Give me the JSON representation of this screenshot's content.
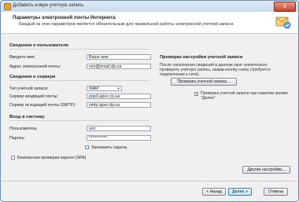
{
  "window": {
    "title": "Добавить новую учетную запись",
    "close_glyph": "x"
  },
  "header": {
    "title": "Параметры электронной почты Интернета",
    "subtitle": "Каждый из этих параметров является обязательным для правильной работы электронной учетной записи."
  },
  "user_info": {
    "heading": "Сведения о пользователе",
    "name_label": "Введите имя:",
    "name_value": "Ваше имя",
    "email_label": "Адрес электронной почты:",
    "email_value": "ven@email.dp.ua"
  },
  "server_info": {
    "heading": "Сведения о сервере",
    "account_type_label": "Тип учетной записи:",
    "account_type_value": "IMAP",
    "incoming_label": "Сервер входящей почты:",
    "incoming_value": "pop3.apex.cp.ua",
    "outgoing_label": "Сервер исходящей почты (SMTP):",
    "outgoing_value": "smtp.apex.dp.ua"
  },
  "login": {
    "heading": "Вход в систему",
    "user_label": "Пользователь:",
    "user_value": "ven",
    "password_label": "Пароль:",
    "password_value": "**********",
    "remember_label": "Запомнить пароль",
    "remember_checked": false,
    "spa_label": "Безопасная проверка пароля (SPA)",
    "spa_checked": false
  },
  "test": {
    "heading": "Проверка настройки учетной записи",
    "description": "После заполнения сведений в данном окне значительно проверить учетную запись, нажав кнопку снизу (требуется подключение к сети).",
    "test_button": "Проверка учетной записи...",
    "auto_test_label": "Проверка учетной записи при нажатии кнопки \"Далее\"",
    "auto_test_checked": true,
    "check_glyph": "✓"
  },
  "buttons": {
    "more_settings": "Другие настройки...",
    "back": "< Назад",
    "next": "Далее >",
    "cancel": "Отмена"
  }
}
